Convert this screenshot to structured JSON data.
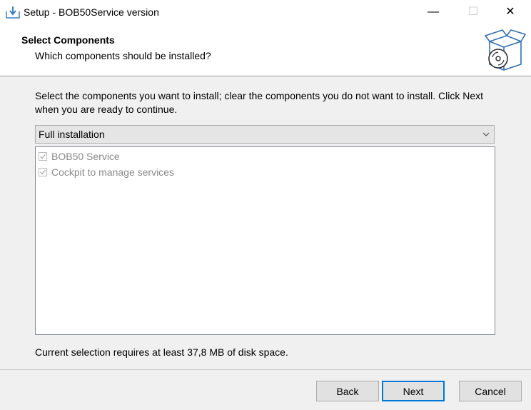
{
  "window": {
    "title": "Setup - BOB50Service version",
    "app_icon": "installer-icon",
    "controls": {
      "minimize": "—",
      "maximize": "☐",
      "close": "✕"
    }
  },
  "header": {
    "title": "Select Components",
    "subtitle": "Which components should be installed?",
    "image_icon": "box-disc-icon"
  },
  "main": {
    "description": "Select the components you want to install; clear the components you do not want to install. Click Next when you are ready to continue.",
    "installation_type": {
      "selected": "Full installation"
    },
    "components": [
      {
        "label": "BOB50 Service",
        "checked": true,
        "enabled": false
      },
      {
        "label": "Cockpit to manage services",
        "checked": true,
        "enabled": false
      }
    ],
    "disk_space": "Current selection requires at least 37,8 MB of disk space."
  },
  "footer": {
    "back_label": "Back",
    "next_label": "Next",
    "cancel_label": "Cancel"
  },
  "colors": {
    "accent": "#0078d7",
    "panel_bg": "#f0f0f0",
    "disabled_text": "#8a8a8a"
  }
}
